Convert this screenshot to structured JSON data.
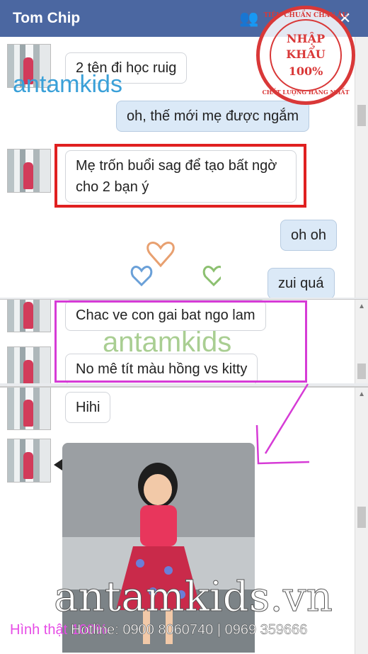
{
  "chat": {
    "title": "Tom Chip",
    "messages": {
      "m1": "2 tên đi học ruig",
      "m2": "oh, thế mới mẹ được ngắm",
      "m3": "Mẹ trốn buổi sag để tạo bất ngờ cho 2 bạn ý",
      "m4": "oh oh",
      "m5": "zui quá",
      "m6": "Chac ve con gai bat ngo lam",
      "m7": "No mê tít màu hồng vs kitty",
      "m8": "Hihi"
    }
  },
  "watermark": {
    "brand": "antamkids",
    "site": "antamkids.vn",
    "caption": "Hình thật 100%",
    "hotline": "Hotline: 0900 8060740 | 0969 359666"
  },
  "stamp": {
    "line1": "NHẬP",
    "line2": "KHẨU",
    "line3": "100%",
    "ring_top": "TIÊU CHUẨN CHÂU ÂU",
    "ring_bottom": "CHẤT LƯỢNG HÀNG NHẤT"
  },
  "colors": {
    "header": "#4b67a1",
    "highlight_red": "#e02020",
    "highlight_pink": "#d63bd6",
    "stamp_red": "#d93838"
  }
}
